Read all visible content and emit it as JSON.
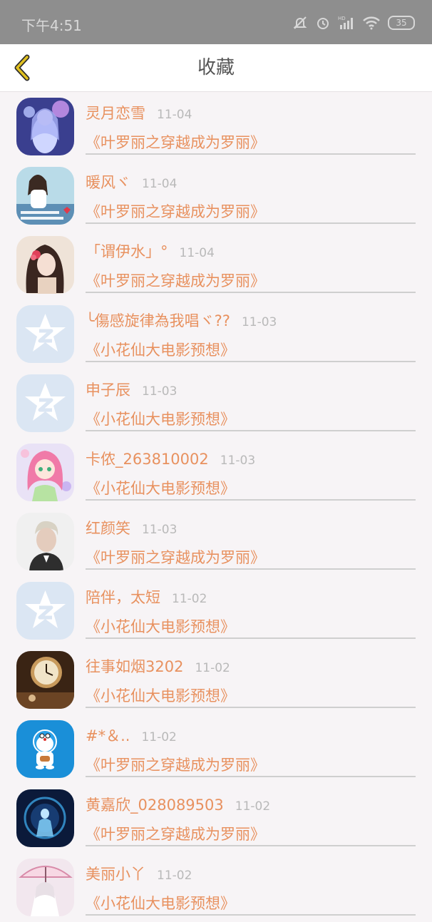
{
  "status_bar": {
    "time": "下午4:51",
    "battery": "35",
    "network_label": "HD"
  },
  "header": {
    "title": "收藏",
    "back_icon": "chevron-left-icon",
    "accent": "#e0c020"
  },
  "colors": {
    "name_text": "#e8915f",
    "date_text": "#b9b9b9",
    "divider": "#cfcfcf",
    "background": "#f7f4f6"
  },
  "favorites": [
    {
      "name": "灵月恋雪",
      "date": "11-04",
      "title": "《叶罗丽之穿越成为罗丽》",
      "avatar": "anime-girl-avatar"
    },
    {
      "name": "暖风ヾ",
      "date": "11-04",
      "title": "《叶罗丽之穿越成为罗丽》",
      "avatar": "girl-photo-avatar"
    },
    {
      "name": "「谓伊水」°",
      "date": "11-04",
      "title": "《叶罗丽之穿越成为罗丽》",
      "avatar": "painted-girl-avatar"
    },
    {
      "name": "╰傷感旋律為我唱ヾ??",
      "date": "11-03",
      "title": "《小花仙大电影预想》",
      "avatar": "default-qzone-avatar"
    },
    {
      "name": "申子辰",
      "date": "11-03",
      "title": "《小花仙大电影预想》",
      "avatar": "default-qzone-avatar"
    },
    {
      "name": "卡侬_263810002",
      "date": "11-03",
      "title": "《小花仙大电影预想》",
      "avatar": "pink-hair-girl-avatar"
    },
    {
      "name": "红颜笑",
      "date": "11-03",
      "title": "《叶罗丽之穿越成为罗丽》",
      "avatar": "man-portrait-avatar"
    },
    {
      "name": "陪伴，太短",
      "date": "11-02",
      "title": "《小花仙大电影预想》",
      "avatar": "default-qzone-avatar"
    },
    {
      "name": "往事如烟3202",
      "date": "11-02",
      "title": "《小花仙大电影预想》",
      "avatar": "clock-avatar"
    },
    {
      "name": "#*＆..",
      "date": "11-02",
      "title": "《叶罗丽之穿越成为罗丽》",
      "avatar": "doraemon-avatar"
    },
    {
      "name": "黄嘉欣_028089503",
      "date": "11-02",
      "title": "《叶罗丽之穿越成为罗丽》",
      "avatar": "blue-angel-avatar"
    },
    {
      "name": "美丽小丫",
      "date": "11-02",
      "title": "《小花仙大电影预想》",
      "avatar": "umbrella-girl-avatar"
    }
  ]
}
